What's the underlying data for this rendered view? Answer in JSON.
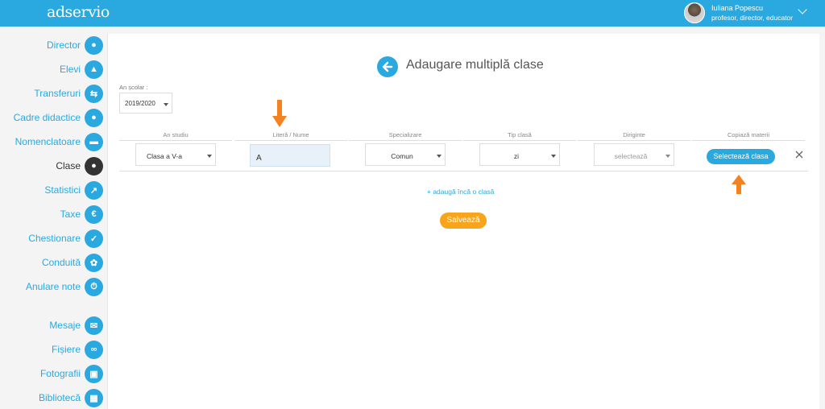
{
  "header": {
    "logo": "adservio",
    "user_name": "Iuliana Popescu",
    "user_role": "profesor, director, educator"
  },
  "sidebar": {
    "items": [
      {
        "label": "Director",
        "icon": "person-tie-icon"
      },
      {
        "label": "Elevi",
        "icon": "graduate-icon"
      },
      {
        "label": "Transferuri",
        "icon": "transfer-arrows-icon"
      },
      {
        "label": "Cadre didactice",
        "icon": "teacher-icon"
      },
      {
        "label": "Nomenclatoare",
        "icon": "list-bar-icon"
      },
      {
        "label": "Clase",
        "icon": "group-icon",
        "active": true
      },
      {
        "label": "Statistici",
        "icon": "trend-line-icon"
      },
      {
        "label": "Taxe",
        "icon": "euro-coin-icon"
      },
      {
        "label": "Chestionare",
        "icon": "checklist-icon"
      },
      {
        "label": "Conduită",
        "icon": "medal-icon"
      },
      {
        "label": "Anulare note",
        "icon": "timer-hand-icon"
      },
      {
        "label": "Mesaje",
        "icon": "envelope-icon"
      },
      {
        "label": "Fișiere",
        "icon": "paperclip-icon"
      },
      {
        "label": "Fotografii",
        "icon": "photos-icon"
      },
      {
        "label": "Bibliotecă",
        "icon": "books-icon"
      }
    ]
  },
  "page": {
    "title": "Adaugare multiplă clase",
    "year_label": "An școlar :",
    "year_value": "2019/2020",
    "columns": [
      "An studiu",
      "Literă / Nume",
      "Specializare",
      "Tip clasă",
      "Diriginte",
      "Copiază materii"
    ],
    "row": {
      "an_studiu": "Clasa a V-a",
      "nume": "A",
      "specializare": "Comun",
      "tip": "zi",
      "diriginte": "selectează",
      "copy_button": "Selectează clasa"
    },
    "add_link": "+ adaugă încă o clasă",
    "save_button": "Salvează"
  },
  "colors": {
    "accent": "#29a9df",
    "save": "#f8a51b",
    "annotation_arrow": "#f58220"
  }
}
